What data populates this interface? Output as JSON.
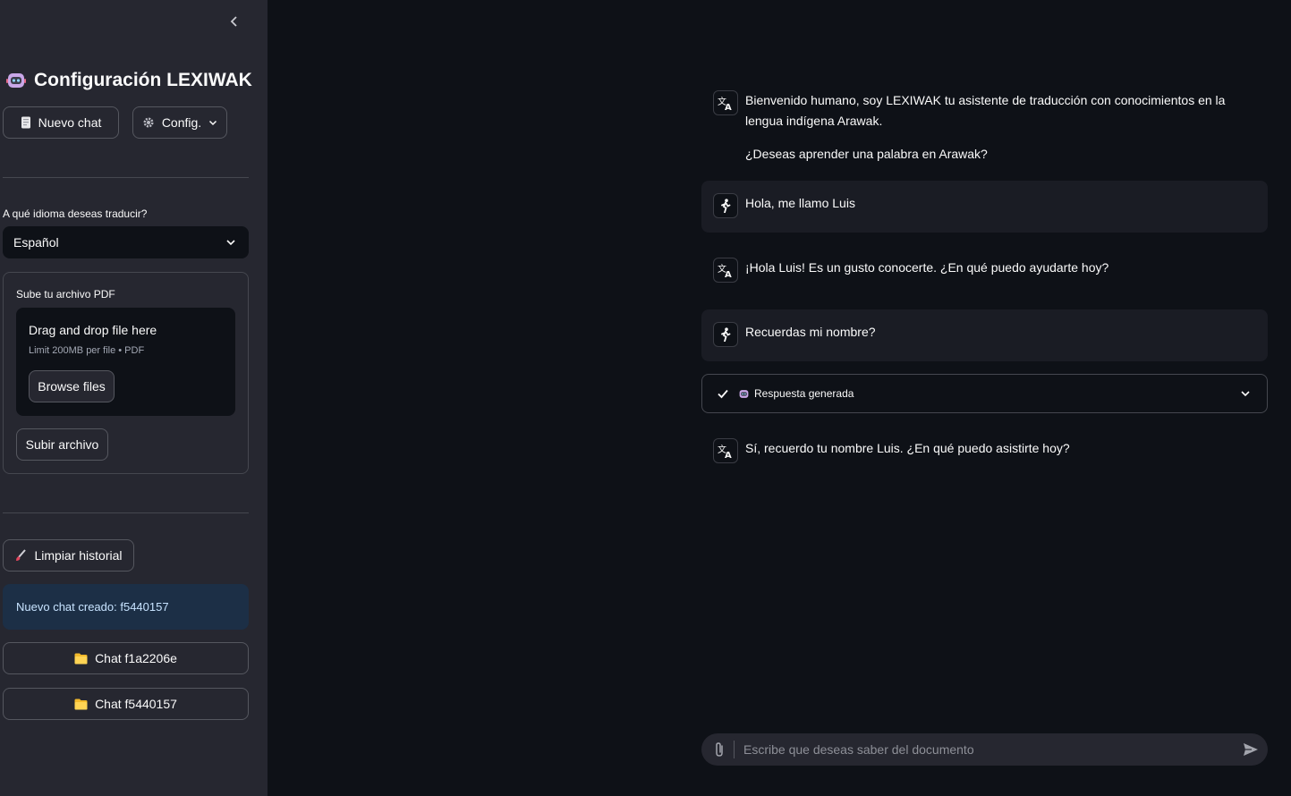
{
  "sidebar": {
    "title": "Configuración LEXIWAK",
    "new_chat_label": "Nuevo chat",
    "config_label": "Config.",
    "language_label": "A qué idioma deseas traducir?",
    "language_selected": "Español",
    "upload_label": "Sube tu archivo PDF",
    "dropzone_title": "Drag and drop file here",
    "dropzone_limit": "Limit 200MB per file • PDF",
    "browse_label": "Browse files",
    "submit_upload_label": "Subir archivo",
    "clear_history_label": "Limpiar historial",
    "info_message": "Nuevo chat creado: f5440157",
    "chats": [
      {
        "label": "Chat f1a2206e"
      },
      {
        "label": "Chat f5440157"
      }
    ]
  },
  "messages": [
    {
      "role": "assistant",
      "text": "Bienvenido humano, soy LEXIWAK tu asistente de traducción con conocimientos en la lengua indígena Arawak.",
      "text2": "¿Deseas aprender una palabra en Arawak?"
    },
    {
      "role": "user",
      "text": "Hola, me llamo Luis"
    },
    {
      "role": "assistant",
      "text": "¡Hola Luis! Es un gusto conocerte. ¿En qué puedo ayudarte hoy?"
    },
    {
      "role": "user",
      "text": "Recuerdas mi nombre?"
    },
    {
      "role": "assistant",
      "text": "Sí, recuerdo tu nombre Luis. ¿En qué puedo asistirte hoy?"
    }
  ],
  "status": {
    "label": "Respuesta generada"
  },
  "chat_input": {
    "placeholder": "Escribe que deseas saber del documento"
  }
}
